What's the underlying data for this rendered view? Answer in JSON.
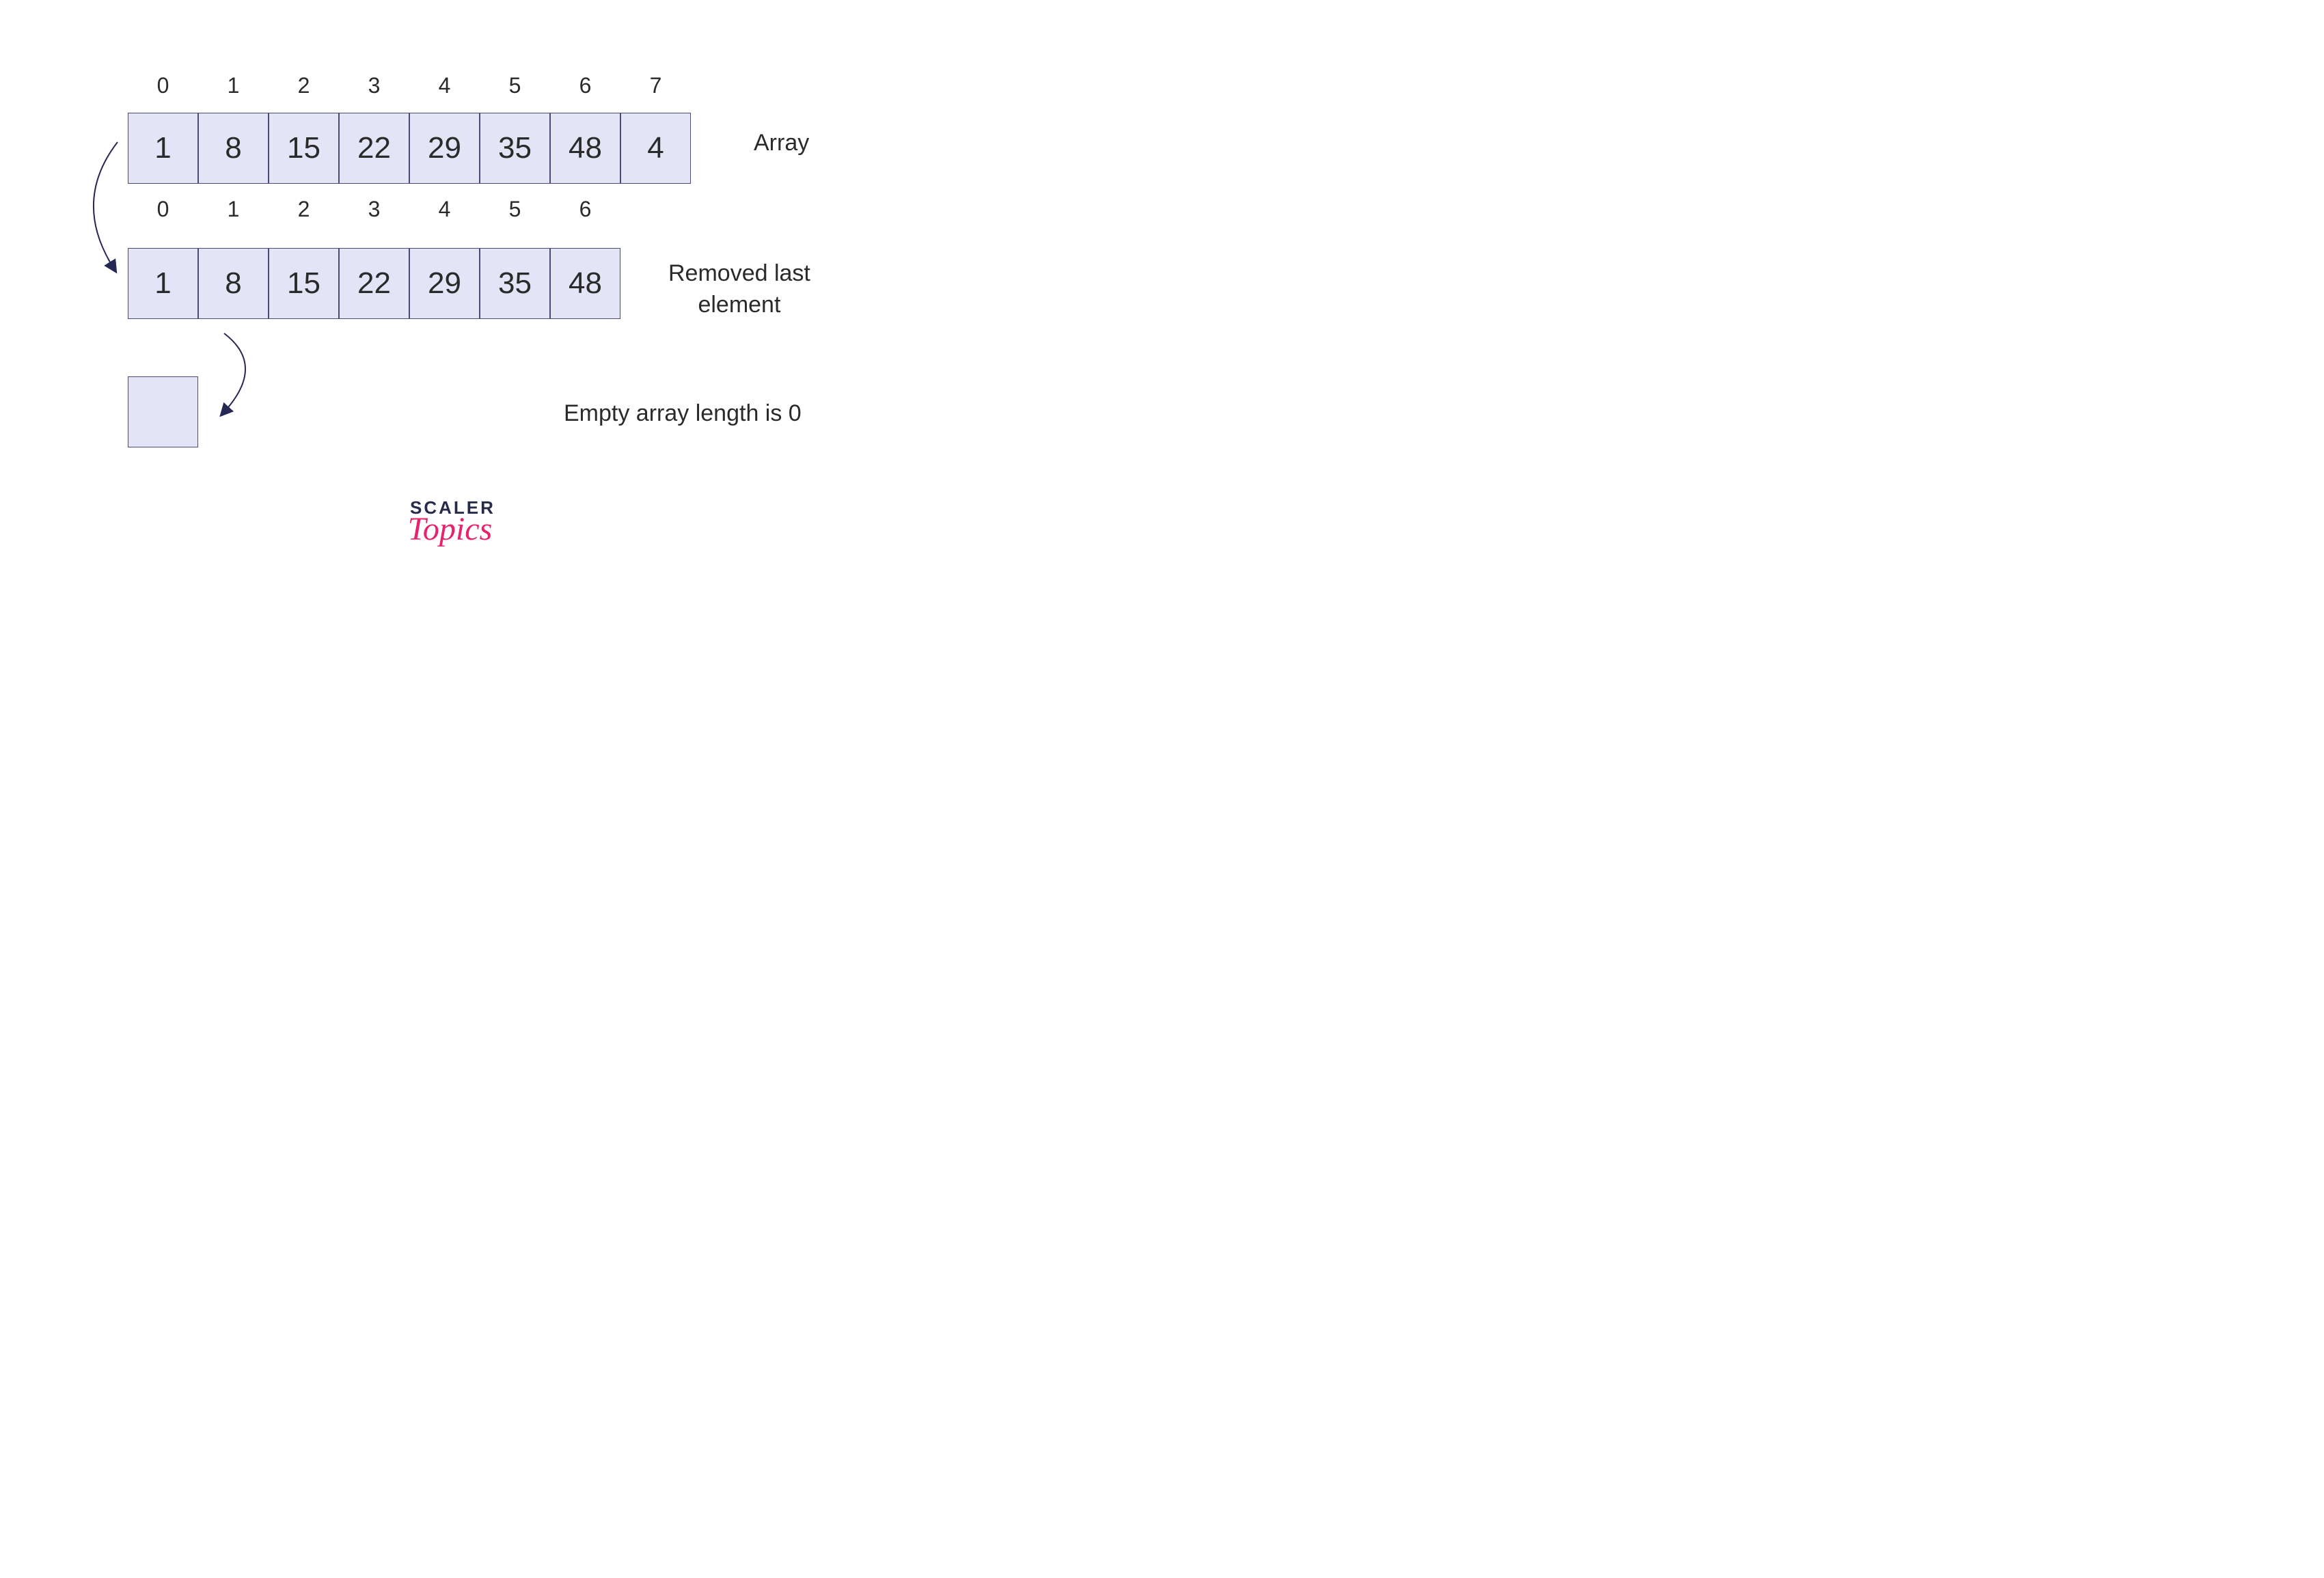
{
  "arrays": {
    "first": {
      "indices": [
        "0",
        "1",
        "2",
        "3",
        "4",
        "5",
        "6",
        "7"
      ],
      "values": [
        "1",
        "8",
        "15",
        "22",
        "29",
        "35",
        "48",
        "4"
      ],
      "label": "Array"
    },
    "second": {
      "indices": [
        "0",
        "1",
        "2",
        "3",
        "4",
        "5",
        "6"
      ],
      "values": [
        "1",
        "8",
        "15",
        "22",
        "29",
        "35",
        "48"
      ],
      "label": "Removed last\nelement"
    },
    "third": {
      "label": "Empty array length is 0"
    }
  },
  "logo": {
    "line1": "SCALER",
    "line2": "Topics"
  },
  "colors": {
    "cell_bg": "#e4e4f7",
    "cell_border": "#4a4a7a",
    "arrow": "#252852",
    "text": "#2a2a2a",
    "logo_primary": "#262b4a",
    "logo_accent": "#e6236d"
  }
}
